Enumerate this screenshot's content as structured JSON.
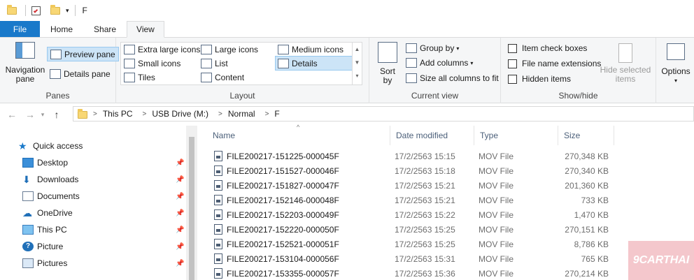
{
  "window": {
    "title": "F"
  },
  "ribbon_tabs": [
    {
      "label": "File"
    },
    {
      "label": "Home"
    },
    {
      "label": "Share"
    },
    {
      "label": "View"
    }
  ],
  "panes_group": {
    "navigation_pane": "Navigation pane",
    "preview_pane": "Preview pane",
    "details_pane": "Details pane",
    "label": "Panes"
  },
  "layout_group": {
    "options": [
      "Extra large icons",
      "Large icons",
      "Medium icons",
      "Small icons",
      "List",
      "Details",
      "Tiles",
      "Content"
    ],
    "selected": "Details",
    "label": "Layout"
  },
  "current_view_group": {
    "sort_by": "Sort by",
    "group_by": "Group by",
    "add_columns": "Add columns",
    "size_all": "Size all columns to fit",
    "label": "Current view"
  },
  "show_hide_group": {
    "item_check_boxes": "Item check boxes",
    "file_name_extensions": "File name extensions",
    "hidden_items": "Hidden items",
    "hide_selected": "Hide selected items",
    "label": "Show/hide"
  },
  "options": "Options",
  "breadcrumb": [
    "This PC",
    "USB Drive (M:)",
    "Normal",
    "F"
  ],
  "nav_pane": [
    {
      "label": "Quick access",
      "icon": "star-icon"
    },
    {
      "label": "Desktop",
      "icon": "desktop-icon"
    },
    {
      "label": "Downloads",
      "icon": "download-icon"
    },
    {
      "label": "Documents",
      "icon": "documents-icon"
    },
    {
      "label": "OneDrive",
      "icon": "cloud-icon"
    },
    {
      "label": "This PC",
      "icon": "computer-icon"
    },
    {
      "label": "Picture",
      "icon": "help-icon"
    },
    {
      "label": "Pictures",
      "icon": "pictures-icon"
    }
  ],
  "columns": [
    "Name",
    "Date modified",
    "Type",
    "Size"
  ],
  "files": [
    {
      "name": "FILE200217-151225-000045F",
      "date": "17/2/2563 15:15",
      "type": "MOV File",
      "size": "270,348 KB"
    },
    {
      "name": "FILE200217-151527-000046F",
      "date": "17/2/2563 15:18",
      "type": "MOV File",
      "size": "270,340 KB"
    },
    {
      "name": "FILE200217-151827-000047F",
      "date": "17/2/2563 15:21",
      "type": "MOV File",
      "size": "201,360 KB"
    },
    {
      "name": "FILE200217-152146-000048F",
      "date": "17/2/2563 15:21",
      "type": "MOV File",
      "size": "733 KB"
    },
    {
      "name": "FILE200217-152203-000049F",
      "date": "17/2/2563 15:22",
      "type": "MOV File",
      "size": "1,470 KB"
    },
    {
      "name": "FILE200217-152220-000050F",
      "date": "17/2/2563 15:25",
      "type": "MOV File",
      "size": "270,151 KB"
    },
    {
      "name": "FILE200217-152521-000051F",
      "date": "17/2/2563 15:25",
      "type": "MOV File",
      "size": "8,786 KB"
    },
    {
      "name": "FILE200217-153104-000056F",
      "date": "17/2/2563 15:31",
      "type": "MOV File",
      "size": "765 KB"
    },
    {
      "name": "FILE200217-153355-000057F",
      "date": "17/2/2563 15:36",
      "type": "MOV File",
      "size": "270,214 KB"
    }
  ],
  "watermark": "9CARTHAI",
  "colors": {
    "file_tab": "#1979ca",
    "selection": "#cce4f7",
    "folder": "#f8d775"
  }
}
